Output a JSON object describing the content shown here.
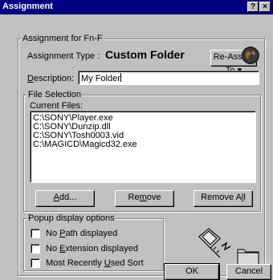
{
  "window": {
    "title": "Assignment",
    "help_glyph": "?",
    "close_glyph": "×"
  },
  "assignment_group": {
    "legend": "Assignment for Fn-F",
    "type_label": "Assignment Type :",
    "type_value": "Custom Folder",
    "reassign_button": "Re-Assign To",
    "description_label_u": "D",
    "description_label_rest": "escription:",
    "description_value": "My Folder"
  },
  "file_selection": {
    "legend": "File Selection",
    "current_files_label": "Current Files:",
    "files": [
      "C:\\SONY\\Player.exe",
      "C:\\SONY\\Dunzip.dll",
      "C:\\SONY\\Tosh0003.vid",
      "C:\\MAGICD\\Magicd32.exe"
    ],
    "add": {
      "u": "A",
      "rest": "dd..."
    },
    "remove": {
      "pre": "Re",
      "u": "m",
      "rest": "ove"
    },
    "remove_all": {
      "pre": "Remove A",
      "u": "l",
      "rest": "l"
    }
  },
  "popup_options": {
    "legend": "Popup display options",
    "options": [
      {
        "pre": "No ",
        "u": "P",
        "rest": "ath displayed",
        "checked": false
      },
      {
        "pre": "No ",
        "u": "E",
        "rest": "xtension displayed",
        "checked": false
      },
      {
        "pre": "Most Recently ",
        "u": "U",
        "rest": "sed Sort",
        "checked": false
      }
    ]
  },
  "footer": {
    "ok": "OK",
    "cancel": "Cancel"
  },
  "icons": {
    "globe": "globe-icon",
    "key_folder": "key-folder-icon"
  }
}
